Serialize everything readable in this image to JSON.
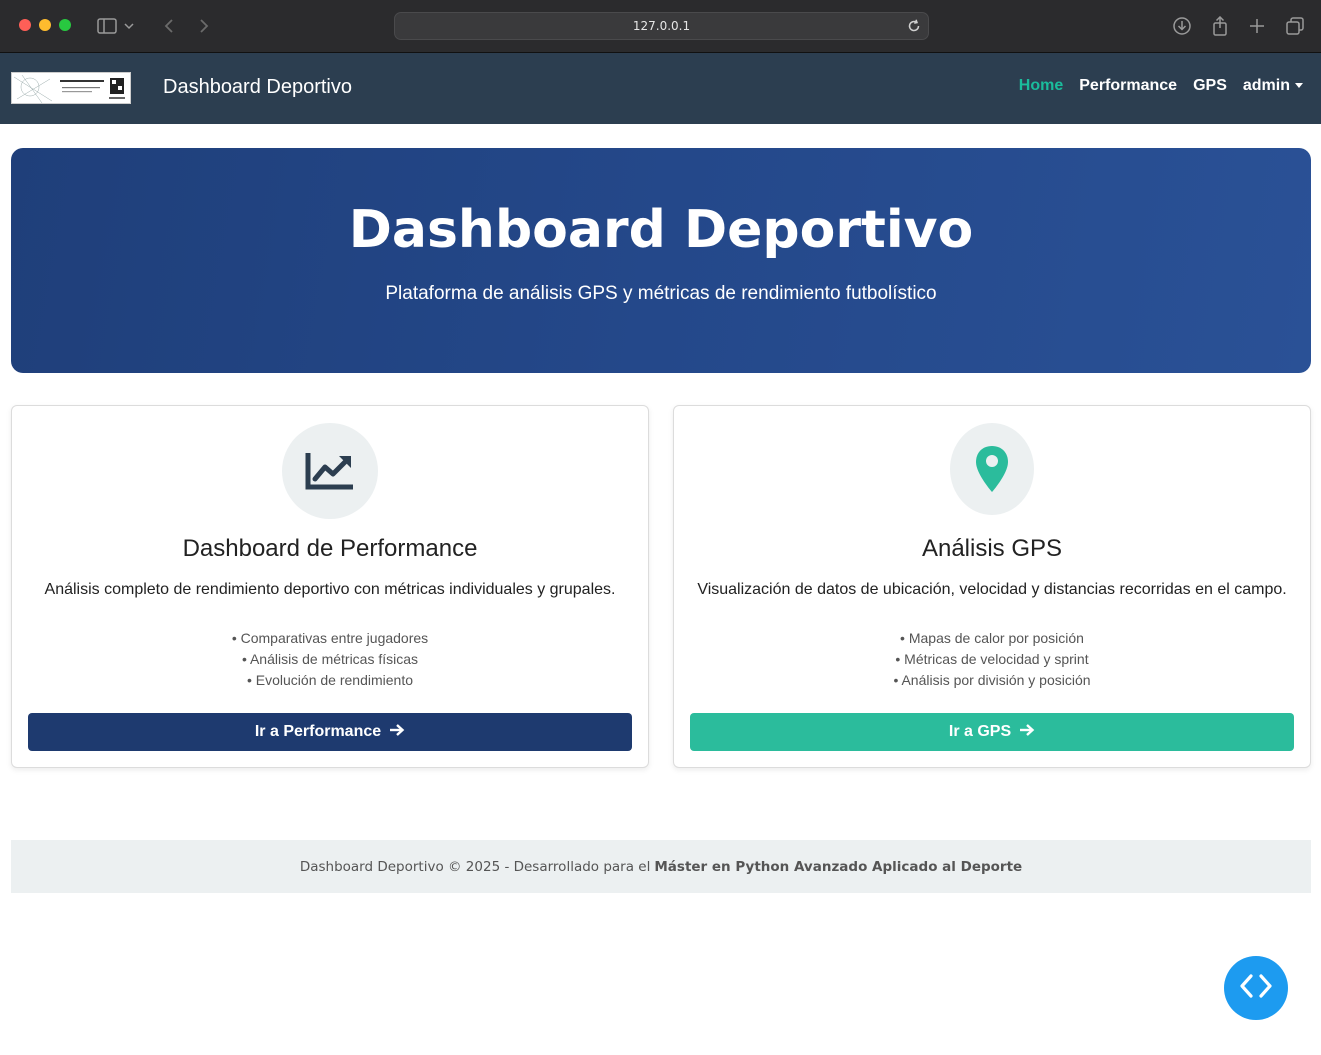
{
  "browser": {
    "url": "127.0.0.1"
  },
  "navbar": {
    "brand_title": "Dashboard Deportivo",
    "logo_text": "Agustín Carpenco",
    "links": [
      {
        "label": "Home",
        "active": true
      },
      {
        "label": "Performance",
        "active": false
      },
      {
        "label": "GPS",
        "active": false
      },
      {
        "label": "admin",
        "active": false
      }
    ],
    "active_color": "#1abc9c",
    "background": "#2c3e50"
  },
  "hero": {
    "title": "Dashboard Deportivo",
    "subtitle": "Plataforma de análisis GPS y métricas de rendimiento futbolístico"
  },
  "cards": [
    {
      "icon": "chart-line-icon",
      "title": "Dashboard de Performance",
      "description": "Análisis completo de rendimiento deportivo con métricas individuales y grupales.",
      "features": [
        "• Comparativas entre jugadores",
        "• Análisis de métricas físicas",
        "• Evolución de rendimiento"
      ],
      "button_label": "Ir a Performance",
      "button_color": "#1e3a6f"
    },
    {
      "icon": "map-marker-icon",
      "title": "Análisis GPS",
      "description": "Visualización de datos de ubicación, velocidad y distancias recorridas en el campo.",
      "features": [
        "• Mapas de calor por posición",
        "• Métricas de velocidad y sprint",
        "• Análisis por división y posición"
      ],
      "button_label": "Ir a GPS",
      "button_color": "#2bbc9c"
    }
  ],
  "footer": {
    "text": "Dashboard Deportivo © 2025 - Desarrollado para el",
    "bold": "Máster en Python Avanzado Aplicado al Deporte"
  },
  "fab": {
    "icon": "code-icon"
  }
}
